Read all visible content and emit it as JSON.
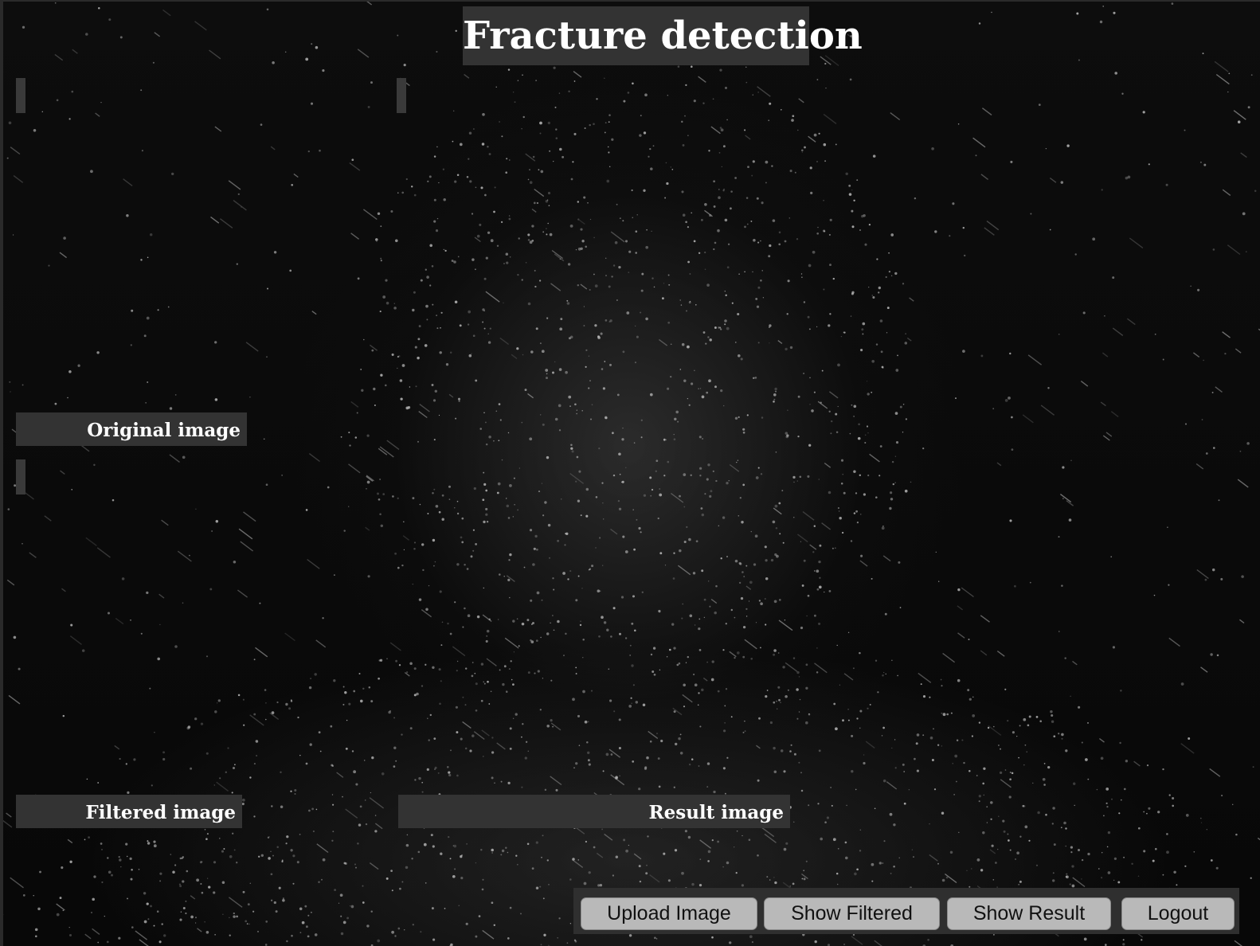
{
  "window": {
    "title": "Fracture detection"
  },
  "labels": {
    "original": "Original image",
    "filtered": "Filtered image",
    "result": "Result image"
  },
  "toolbar": {
    "upload_label": "Upload Image",
    "show_filtered_label": "Show Filtered",
    "show_result_label": "Show Result",
    "logout_label": "Logout"
  },
  "colors": {
    "panel": "#333333",
    "button": "#b9b9b9",
    "text_on_panel": "#ffffff"
  }
}
